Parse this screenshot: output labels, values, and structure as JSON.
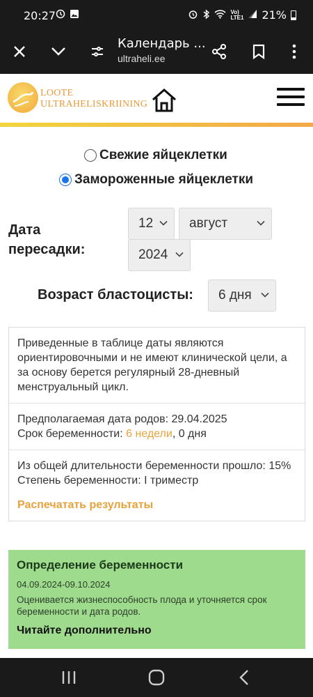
{
  "status_bar": {
    "time": "20:27",
    "battery": "21%"
  },
  "browser": {
    "title": "Календарь ...",
    "url": "ultraheli.ee",
    "icons": [
      "close-icon",
      "chevron-down-icon",
      "page-settings-icon",
      "share-icon",
      "bookmark-icon",
      "more-icon"
    ]
  },
  "site": {
    "logo_line1": "LOOTE",
    "logo_line2": "ULTRAHELISKRIINING",
    "colors": {
      "accent": "#e8a23c",
      "stripe_start": "#f2d53c",
      "stripe_end": "#f3a84a",
      "green_box": "#9fdb8c"
    }
  },
  "form": {
    "radio_options": [
      {
        "label": "Свежие яйцеклетки",
        "checked": false
      },
      {
        "label": "Замороженные яйцеклетки",
        "checked": true
      }
    ],
    "transfer_label": "Дата пересадки:",
    "day": "12",
    "month": "август",
    "year": "2024",
    "blast_age_label": "Возраст бластоцисты:",
    "blast_age": "6 дня"
  },
  "results": {
    "disclaimer": "Приведенные в таблице даты являются ориентировочными и не имеют клинической цели, а за основу берется регулярный 28-дневный менструальный цикл.",
    "due_date_label": "Предполагаемая дата родов:",
    "due_date": "29.04.2025",
    "term_label": "Срок беременности:",
    "term_weeks": "6 недели",
    "term_days": ", 0 дня",
    "progress_text": "Из общей длительности беременности прошло: 15%",
    "trimester_label": "Степень беременности:",
    "trimester": "I триместр",
    "print_link": "Распечатать результаты"
  },
  "card": {
    "title": "Определение беременности",
    "date_range": "04.09.2024-09.10.2024",
    "description": "Оценивается жизнеспособность плода и уточняется срок беременности и дата родов.",
    "read_more": "Читайте дополнительно"
  }
}
